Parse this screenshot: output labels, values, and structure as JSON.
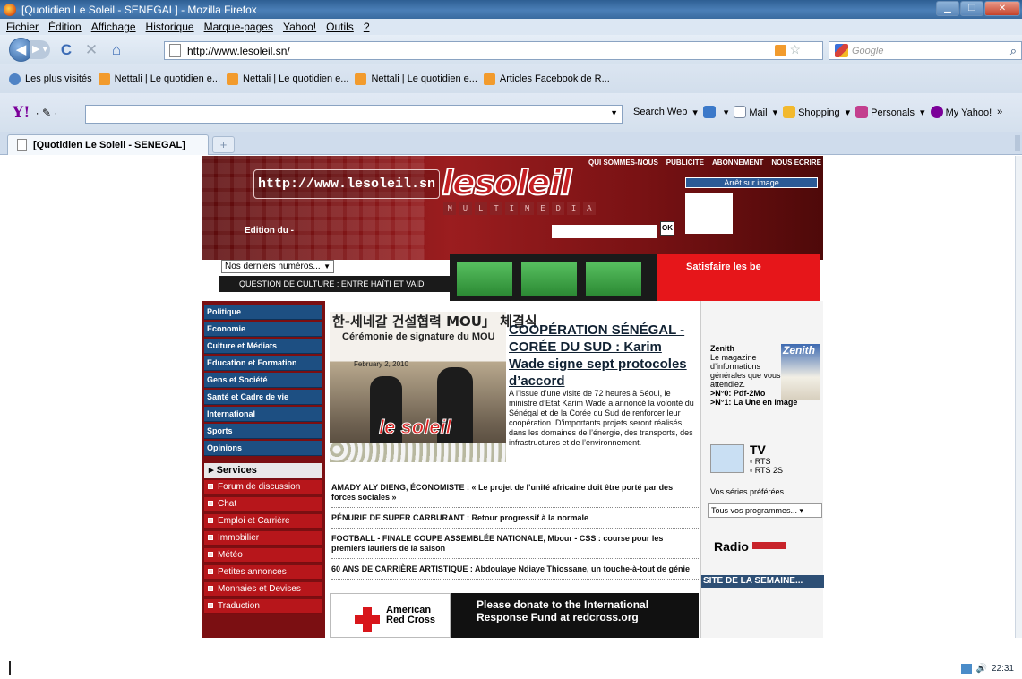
{
  "window": {
    "title": "[Quotidien Le Soleil - SENEGAL] - Mozilla Firefox"
  },
  "menu": [
    "Fichier",
    "Édition",
    "Affichage",
    "Historique",
    "Marque-pages",
    "Yahoo!",
    "Outils",
    "?"
  ],
  "nav": {
    "url": "http://www.lesoleil.sn/",
    "search_placeholder": "Google"
  },
  "bookmarks": [
    "Les plus visités",
    "Nettali | Le quotidien e...",
    "Nettali | Le quotidien e...",
    "Nettali | Le quotidien e...",
    "Articles Facebook de R..."
  ],
  "yahoo": {
    "search_web": "Search Web",
    "mail": "Mail",
    "shopping": "Shopping",
    "personals": "Personals",
    "my_yahoo": "My Yahoo!"
  },
  "tab": {
    "label": "[Quotidien Le Soleil - SENEGAL]"
  },
  "site": {
    "url_bubble": "http://www.lesoleil.sn",
    "logo": "lesoleil",
    "multimedia": [
      "M",
      "U",
      "L",
      "T",
      "I",
      "M",
      "E",
      "D",
      "I",
      "A"
    ],
    "top_links": [
      "QUI SOMMES-NOUS",
      "PUBLICITE",
      "ABONNEMENT",
      "NOUS ECRIRE"
    ],
    "arret": "Arrêt sur image",
    "edition": "Edition du -",
    "ok": "OK",
    "numbers_select": "Nos derniers numéros...",
    "culture_ticker": "QUESTION DE CULTURE : ENTRE HAÏTI ET VAID",
    "ad_banner": "Satisfaire les be",
    "categories": [
      "Politique",
      "Economie",
      "Culture et Médiats",
      "Education et Formation",
      "Gens et Société",
      "Santé et Cadre de vie",
      "International",
      "Sports",
      "Opinions"
    ],
    "services_label": "Services",
    "services": [
      "Forum de discussion",
      "Chat",
      "Emploi et Carrière",
      "Immobilier",
      "Météo",
      "Petites annonces",
      "Monnaies et Devises",
      "Traduction"
    ],
    "photo": {
      "korean": "한-세네갈 건설협력 MOU」 체결식",
      "caption": "Cérémonie de signature du MOU",
      "date": "February 2, 2010",
      "watermark": "le soleil"
    },
    "headline": "COOPÉRATION SÉNÉGAL - CORÉE DU SUD : Karim Wade signe sept protocoles d’accord",
    "lede": "A l’issue d’une visite de 72 heures à Séoul, le ministre d’Etat Karim Wade a annoncé la volonté du Sénégal et de la Corée du Sud de renforcer leur coopération. D’importants projets seront réalisés dans les domaines de l’énergie, des transports, des infrastructures et de l’environnement.",
    "stories": [
      "AMADY ALY DIENG, ÉCONOMISTE : « Le projet de l’unité africaine doit être porté par des forces sociales »",
      "PÉNURIE DE SUPER CARBURANT : Retour progressif à la normale",
      "FOOTBALL - FINALE COUPE ASSEMBLÉE NATIONALE, Mbour - CSS : course pour les premiers lauriers de la saison",
      "60 ANS DE CARRIÈRE ARTISTIQUE : Abdoulaye Ndiaye Thiossane, un touche-à-tout de génie"
    ],
    "redcross": {
      "org": "American Red Cross",
      "text": "Please donate to the International Response Fund at redcross.org"
    },
    "zenith": {
      "title": "Zenith",
      "desc": "Le magazine d’informations générales que vous attendiez.",
      "n0": ">N°0: Pdf-2Mo",
      "n1": ">N°1: La Une en image",
      "cover": "Zenith"
    },
    "tv": {
      "title": "TV",
      "ch1": "RTS",
      "ch2": "RTS 2S",
      "series": "Vos séries préférées",
      "programs": "Tous vos programmes..."
    },
    "radio": "Radio",
    "site_semaine": "SITE DE LA SEMAINE..."
  },
  "tray": {
    "time": "22:31"
  }
}
